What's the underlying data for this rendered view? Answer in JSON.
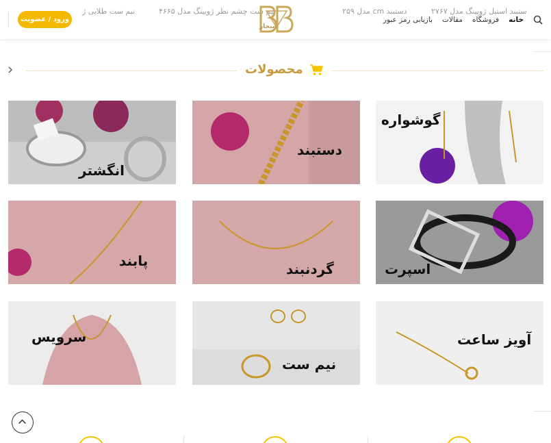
{
  "header": {
    "ticker": [
      "نیم ست طلایی ژ",
      "نیم ست چشم نظر ژوپینگ مدل ۴۶۶۵",
      "دستبند cm مدل ۲۵۹",
      "ستبند استیل ژوپینگ مدل ۲۷۶۷"
    ],
    "login_label": "ورود / عضویت",
    "logo_text": "بیجار",
    "nav": [
      {
        "label": "خانه",
        "active": true
      },
      {
        "label": "فروشگاه",
        "active": false
      },
      {
        "label": "مقالات",
        "active": false
      },
      {
        "label": "بازیابی رمز عبور",
        "active": false
      }
    ]
  },
  "section": {
    "title": "محصولات"
  },
  "categories": [
    {
      "label": "انگشتر"
    },
    {
      "label": "دستبند"
    },
    {
      "label": "گوشواره"
    },
    {
      "label": "پابند"
    },
    {
      "label": "گردنبند"
    },
    {
      "label": "اسپرت"
    },
    {
      "label": "سرویس"
    },
    {
      "label": "نیم ست"
    },
    {
      "label": "آویز ساعت"
    }
  ],
  "colors": {
    "accent": "#f5b800",
    "title": "#c79a3f"
  }
}
